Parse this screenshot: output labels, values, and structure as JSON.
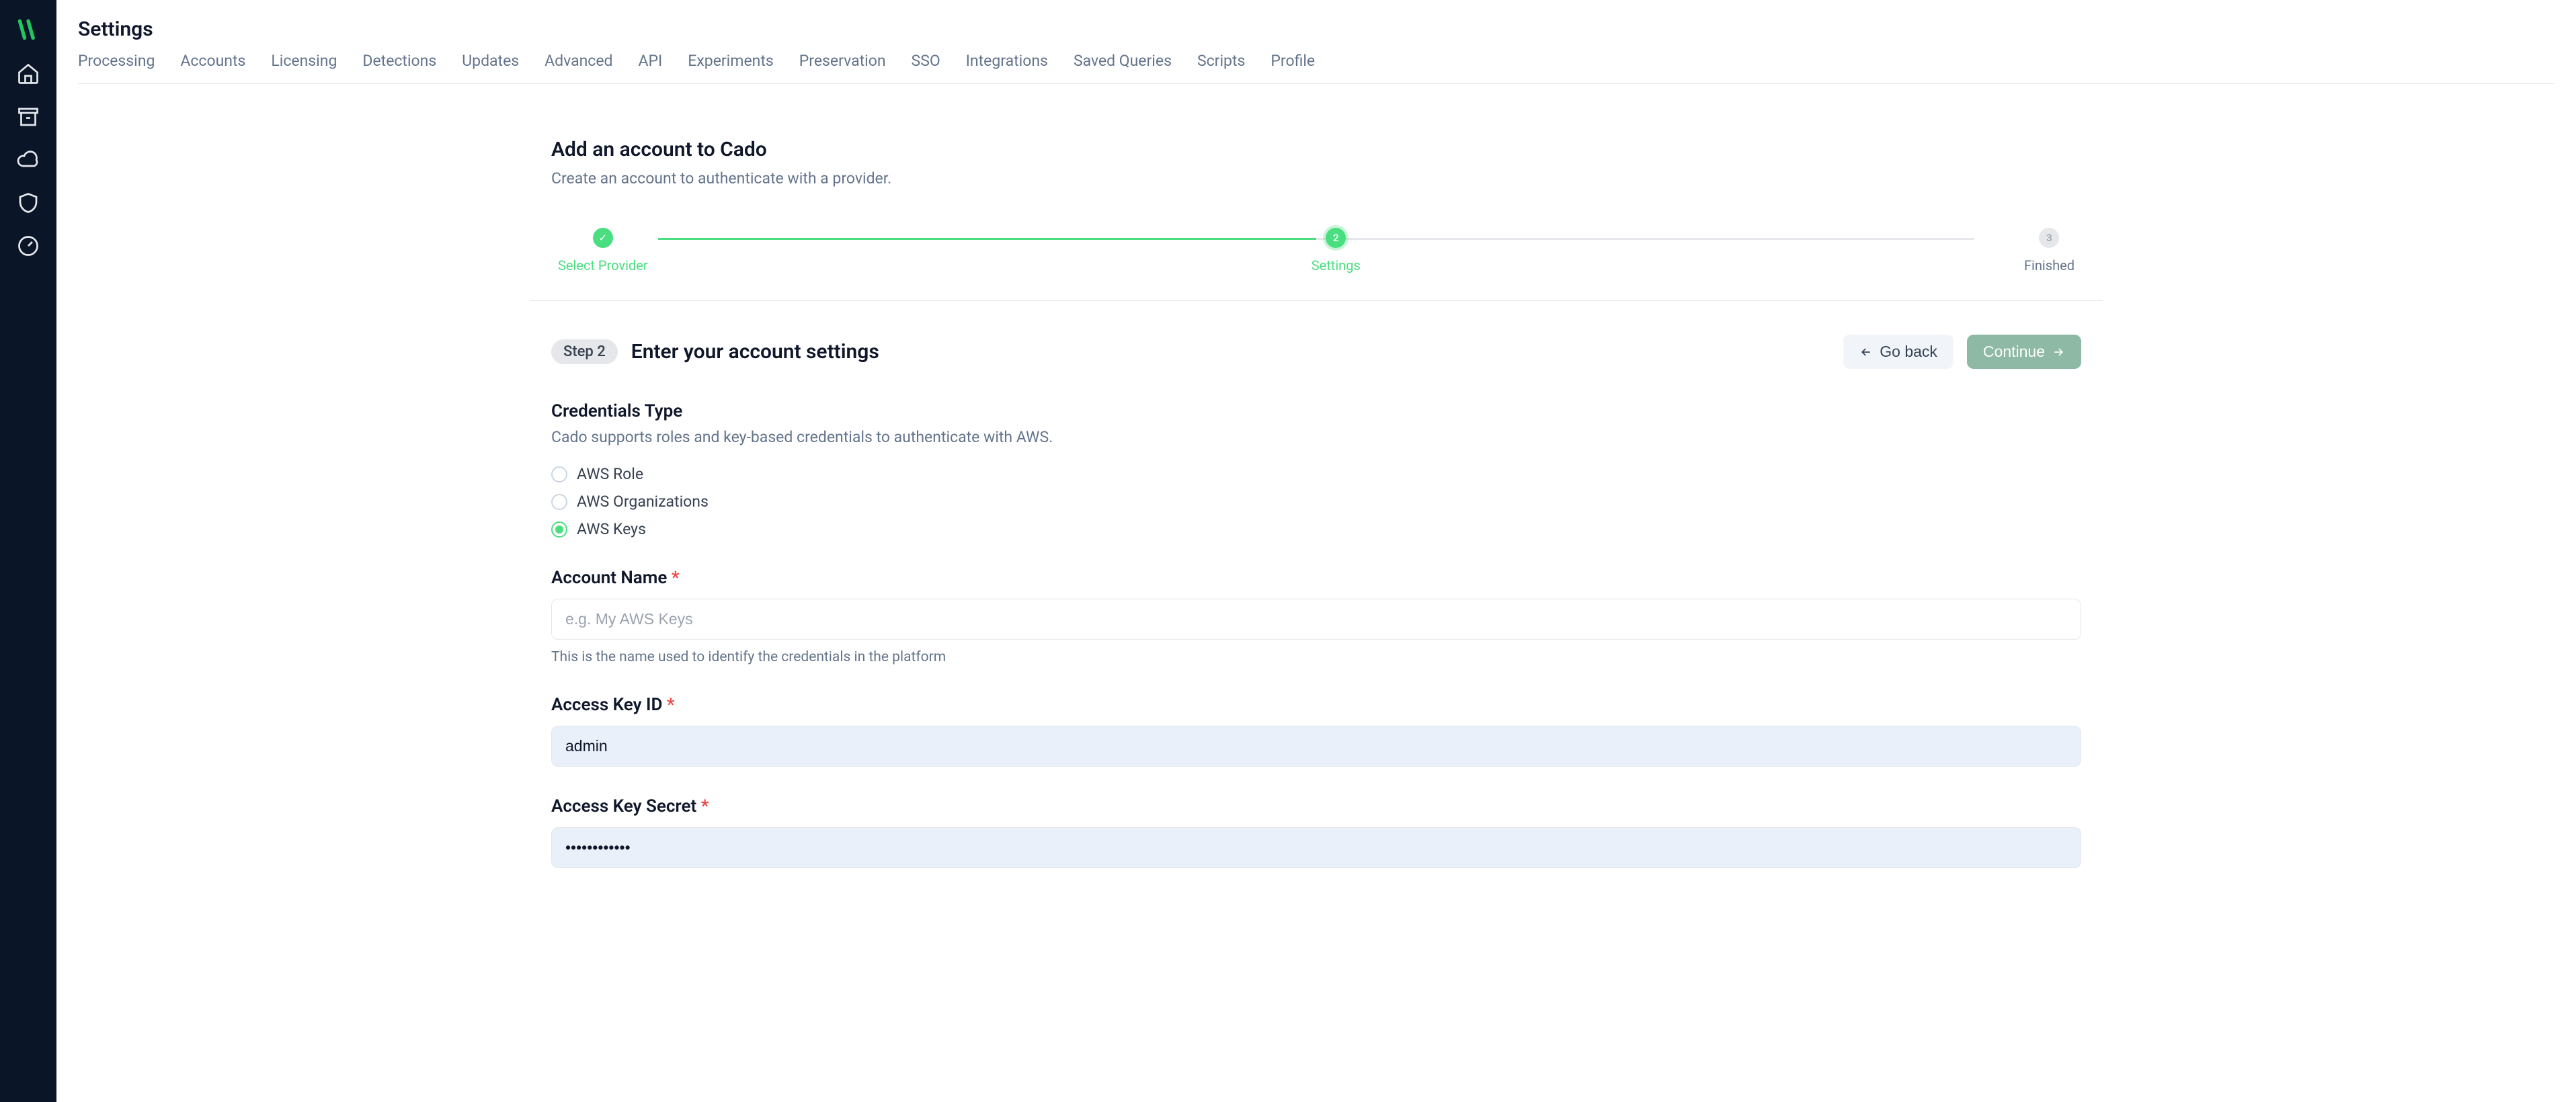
{
  "page": {
    "title": "Settings"
  },
  "tabs": [
    "Processing",
    "Accounts",
    "Licensing",
    "Detections",
    "Updates",
    "Advanced",
    "API",
    "Experiments",
    "Preservation",
    "SSO",
    "Integrations",
    "Saved Queries",
    "Scripts",
    "Profile"
  ],
  "wizard": {
    "title": "Add an account to Cado",
    "subtitle": "Create an account to authenticate with a provider.",
    "steps": {
      "s1": {
        "label": "Select Provider",
        "mark": "✓"
      },
      "s2": {
        "label": "Settings",
        "mark": "2"
      },
      "s3": {
        "label": "Finished",
        "mark": "3"
      }
    },
    "badge": "Step 2",
    "heading": "Enter your account settings",
    "back": "Go back",
    "continue": "Continue"
  },
  "credentials": {
    "title": "Credentials Type",
    "desc": "Cado supports roles and key-based credentials to authenticate with AWS.",
    "options": {
      "role": "AWS Role",
      "orgs": "AWS Organizations",
      "keys": "AWS Keys"
    }
  },
  "fields": {
    "account_name": {
      "label": "Account Name",
      "placeholder": "e.g. My AWS Keys",
      "value": "",
      "help": "This is the name used to identify the credentials in the platform"
    },
    "access_key_id": {
      "label": "Access Key ID",
      "value": "admin"
    },
    "access_key_secret": {
      "label": "Access Key Secret",
      "value": "••••••••••••"
    }
  }
}
